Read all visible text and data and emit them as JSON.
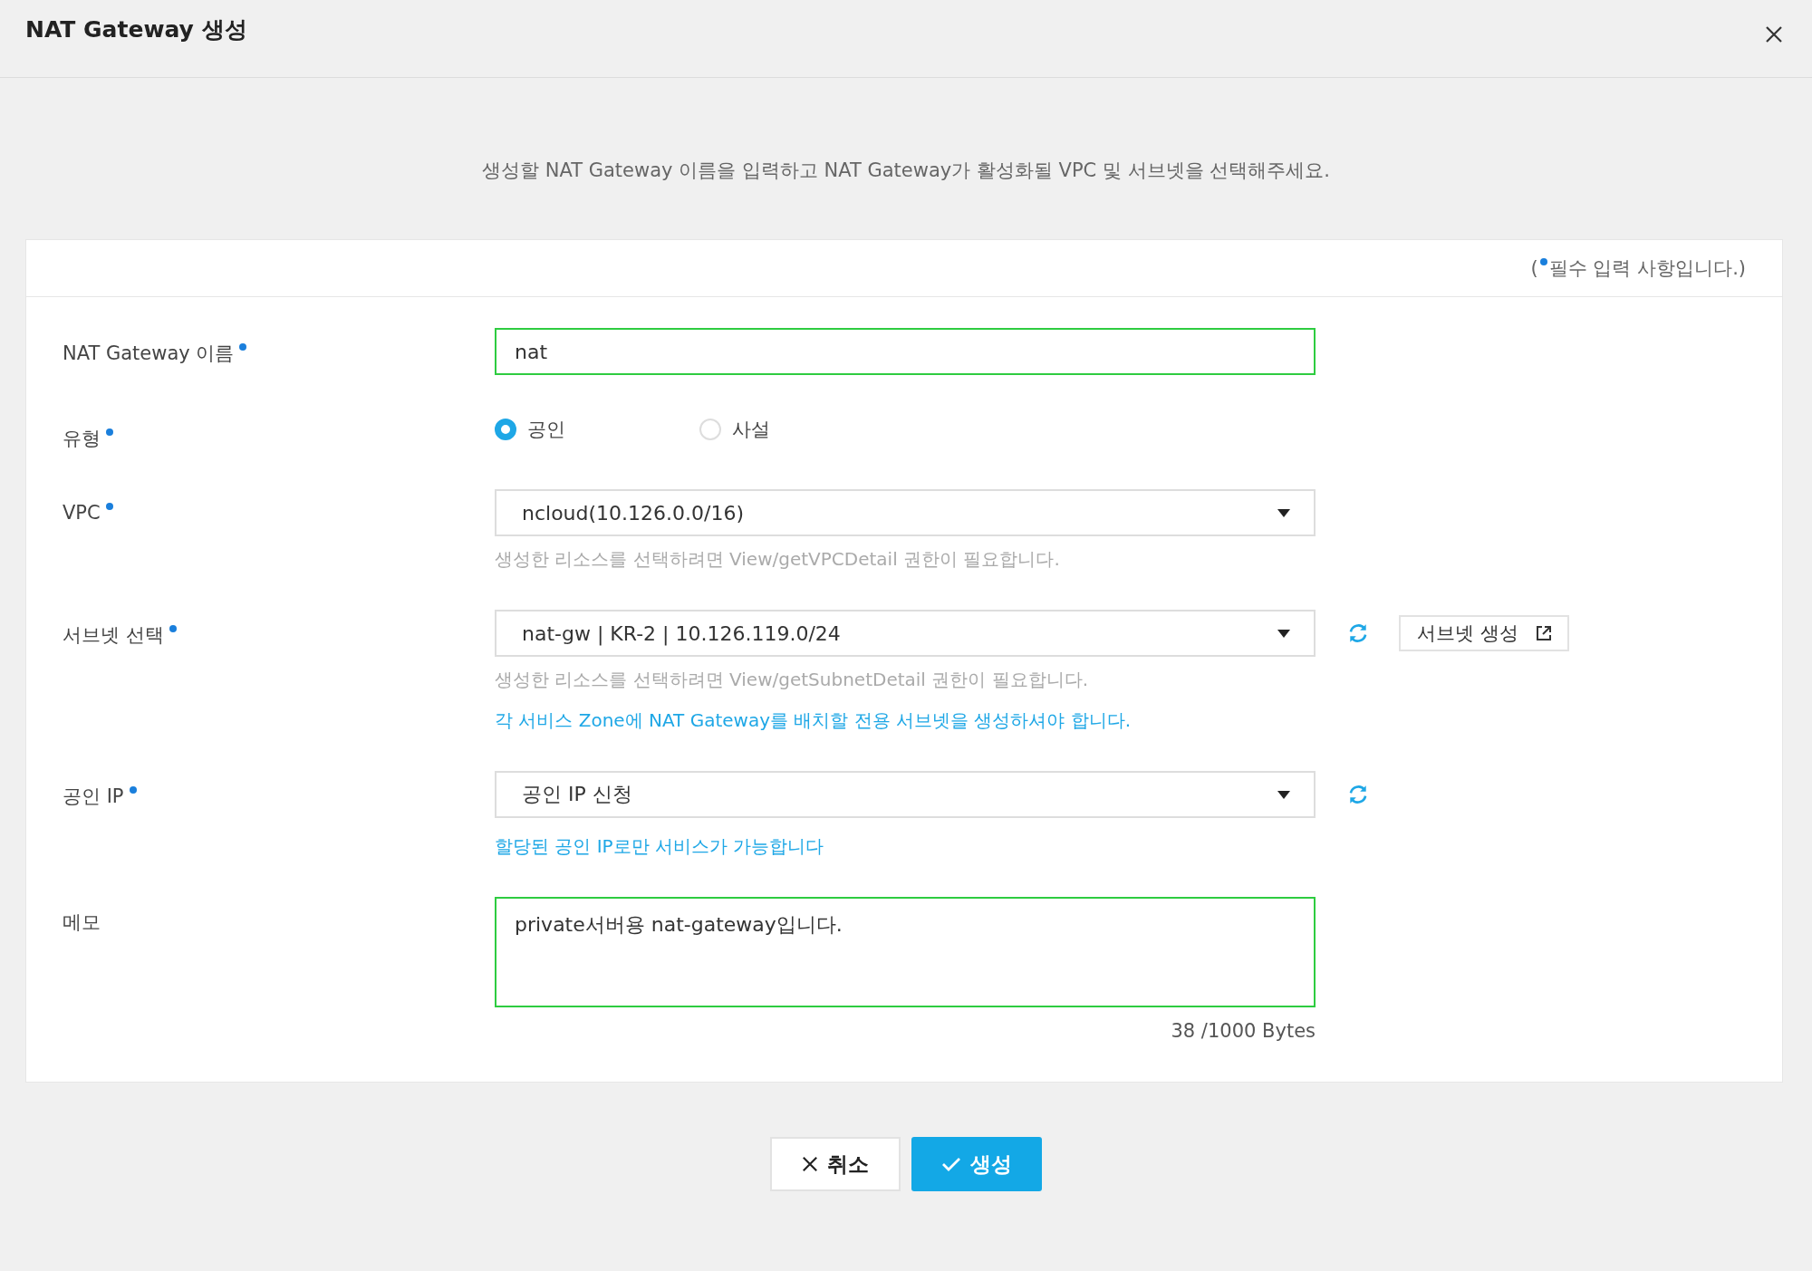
{
  "dialog": {
    "title": "NAT Gateway 생성"
  },
  "intro": "생성할 NAT Gateway 이름을 입력하고 NAT Gateway가 활성화될 VPC 및 서브넷을 선택해주세요.",
  "required_note": {
    "prefix": "(",
    "text": "필수 입력 사항입니다.)"
  },
  "fields": [
    {
      "kind": "text",
      "label": "NAT Gateway 이름",
      "required": true,
      "value": "nat",
      "valid": true
    },
    {
      "kind": "radio",
      "label": "유형",
      "required": true,
      "options": [
        {
          "label": "공인",
          "selected": true
        },
        {
          "label": "사설",
          "selected": false
        }
      ]
    },
    {
      "kind": "select",
      "label": "VPC",
      "required": true,
      "value": "ncloud(10.126.0.0/16)",
      "refresh": false,
      "hints": [
        {
          "text": "생성한 리소스를 선택하려면 View/getVPCDetail 권한이 필요합니다.",
          "kind": "muted"
        }
      ]
    },
    {
      "kind": "select",
      "label": "서브넷 선택",
      "required": true,
      "value": "nat-gw | KR-2 | 10.126.119.0/24",
      "refresh": true,
      "action": {
        "label": "서브넷 생성"
      },
      "hints": [
        {
          "text": "생성한 리소스를 선택하려면 View/getSubnetDetail 권한이 필요합니다.",
          "kind": "muted"
        },
        {
          "text": "각 서비스 Zone에 NAT Gateway를 배치할 전용 서브넷을 생성하셔야 합니다.",
          "kind": "info"
        }
      ]
    },
    {
      "kind": "select",
      "label": "공인 IP",
      "required": true,
      "value": "공인 IP 신청",
      "refresh": true,
      "hints": [
        {
          "text": "할당된 공인 IP로만 서비스가 가능합니다",
          "kind": "info"
        }
      ]
    },
    {
      "kind": "textarea",
      "label": "메모",
      "required": false,
      "value": "private서버용 nat-gateway입니다.",
      "valid": true,
      "counter": "38 /1000 Bytes"
    }
  ],
  "buttons": [
    {
      "label": "취소",
      "kind": "cancel"
    },
    {
      "label": "생성",
      "kind": "primary"
    }
  ]
}
